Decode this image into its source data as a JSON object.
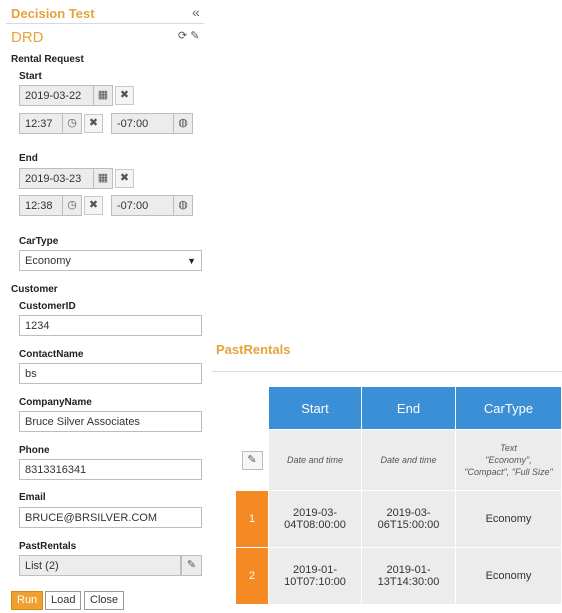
{
  "panel": {
    "title": "Decision Test",
    "collapse_icon": "double-chevron-left-icon",
    "drd_label": "DRD",
    "refresh_icon": "refresh-icon",
    "clear_icon": "eraser-icon"
  },
  "rental": {
    "label": "Rental Request",
    "start": {
      "label": "Start",
      "date": "2019-03-22",
      "time": "12:37",
      "tz": "-07:00"
    },
    "end": {
      "label": "End",
      "date": "2019-03-23",
      "time": "12:38",
      "tz": "-07:00"
    },
    "cartype": {
      "label": "CarType",
      "value": "Economy"
    }
  },
  "customer": {
    "label": "Customer",
    "id": {
      "label": "CustomerID",
      "value": "1234"
    },
    "contact": {
      "label": "ContactName",
      "value": "bs"
    },
    "company": {
      "label": "CompanyName",
      "value": "Bruce Silver Associates"
    },
    "phone": {
      "label": "Phone",
      "value": "8313316341"
    },
    "email": {
      "label": "Email",
      "value": "BRUCE@BRSILVER.COM"
    },
    "pastrentals": {
      "label": "PastRentals",
      "value": "List (2)"
    }
  },
  "actions": {
    "run": "Run",
    "load": "Load",
    "close": "Close"
  },
  "past_rentals": {
    "title": "PastRentals",
    "columns": [
      "Start",
      "End",
      "CarType"
    ],
    "types": [
      "Date and time",
      "Date and time",
      "Text\n\"Economy\",\n\"Compact\", \"Full Size\""
    ],
    "rows": [
      {
        "index": "1",
        "start": "2019-03-\n04T08:00:00",
        "end": "2019-03-\n06T15:00:00",
        "cartype": "Economy"
      },
      {
        "index": "2",
        "start": "2019-01-\n10T07:10:00",
        "end": "2019-01-\n13T14:30:00",
        "cartype": "Economy"
      }
    ]
  },
  "colors": {
    "accent": "#e8a23a",
    "header_blue": "#3b8fd6",
    "index_orange": "#f58a24"
  }
}
